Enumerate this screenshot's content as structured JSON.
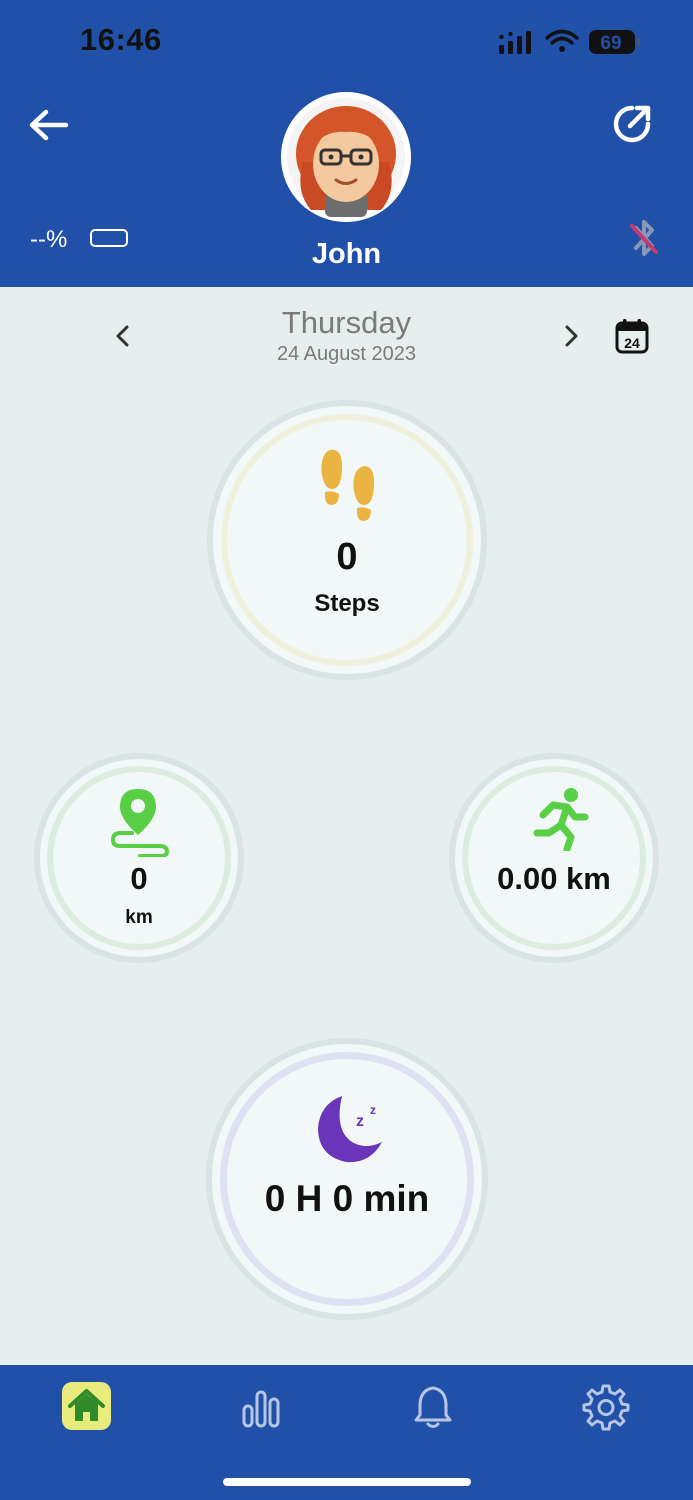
{
  "status_bar": {
    "time": "16:46",
    "battery": "69"
  },
  "profile": {
    "name": "John",
    "device_battery": "--%"
  },
  "date_nav": {
    "day": "Thursday",
    "date": "24 August 2023",
    "calendar_day": "24"
  },
  "metrics": {
    "steps": {
      "value": "0",
      "label": "Steps"
    },
    "distance": {
      "value": "0",
      "unit": "km"
    },
    "activity": {
      "value": "0.00 km"
    },
    "sleep": {
      "value": "0 H 0 min"
    }
  },
  "tabs": [
    {
      "name": "home",
      "active": true
    },
    {
      "name": "statistics",
      "active": false
    },
    {
      "name": "notifications",
      "active": false
    },
    {
      "name": "settings",
      "active": false
    }
  ],
  "colors": {
    "header": "#2150a8",
    "background": "#e6eeee",
    "steps_accent": "#eab442",
    "green_accent": "#58cf45",
    "sleep_accent": "#6a35b8",
    "active_tab": "#e9ec7c"
  }
}
